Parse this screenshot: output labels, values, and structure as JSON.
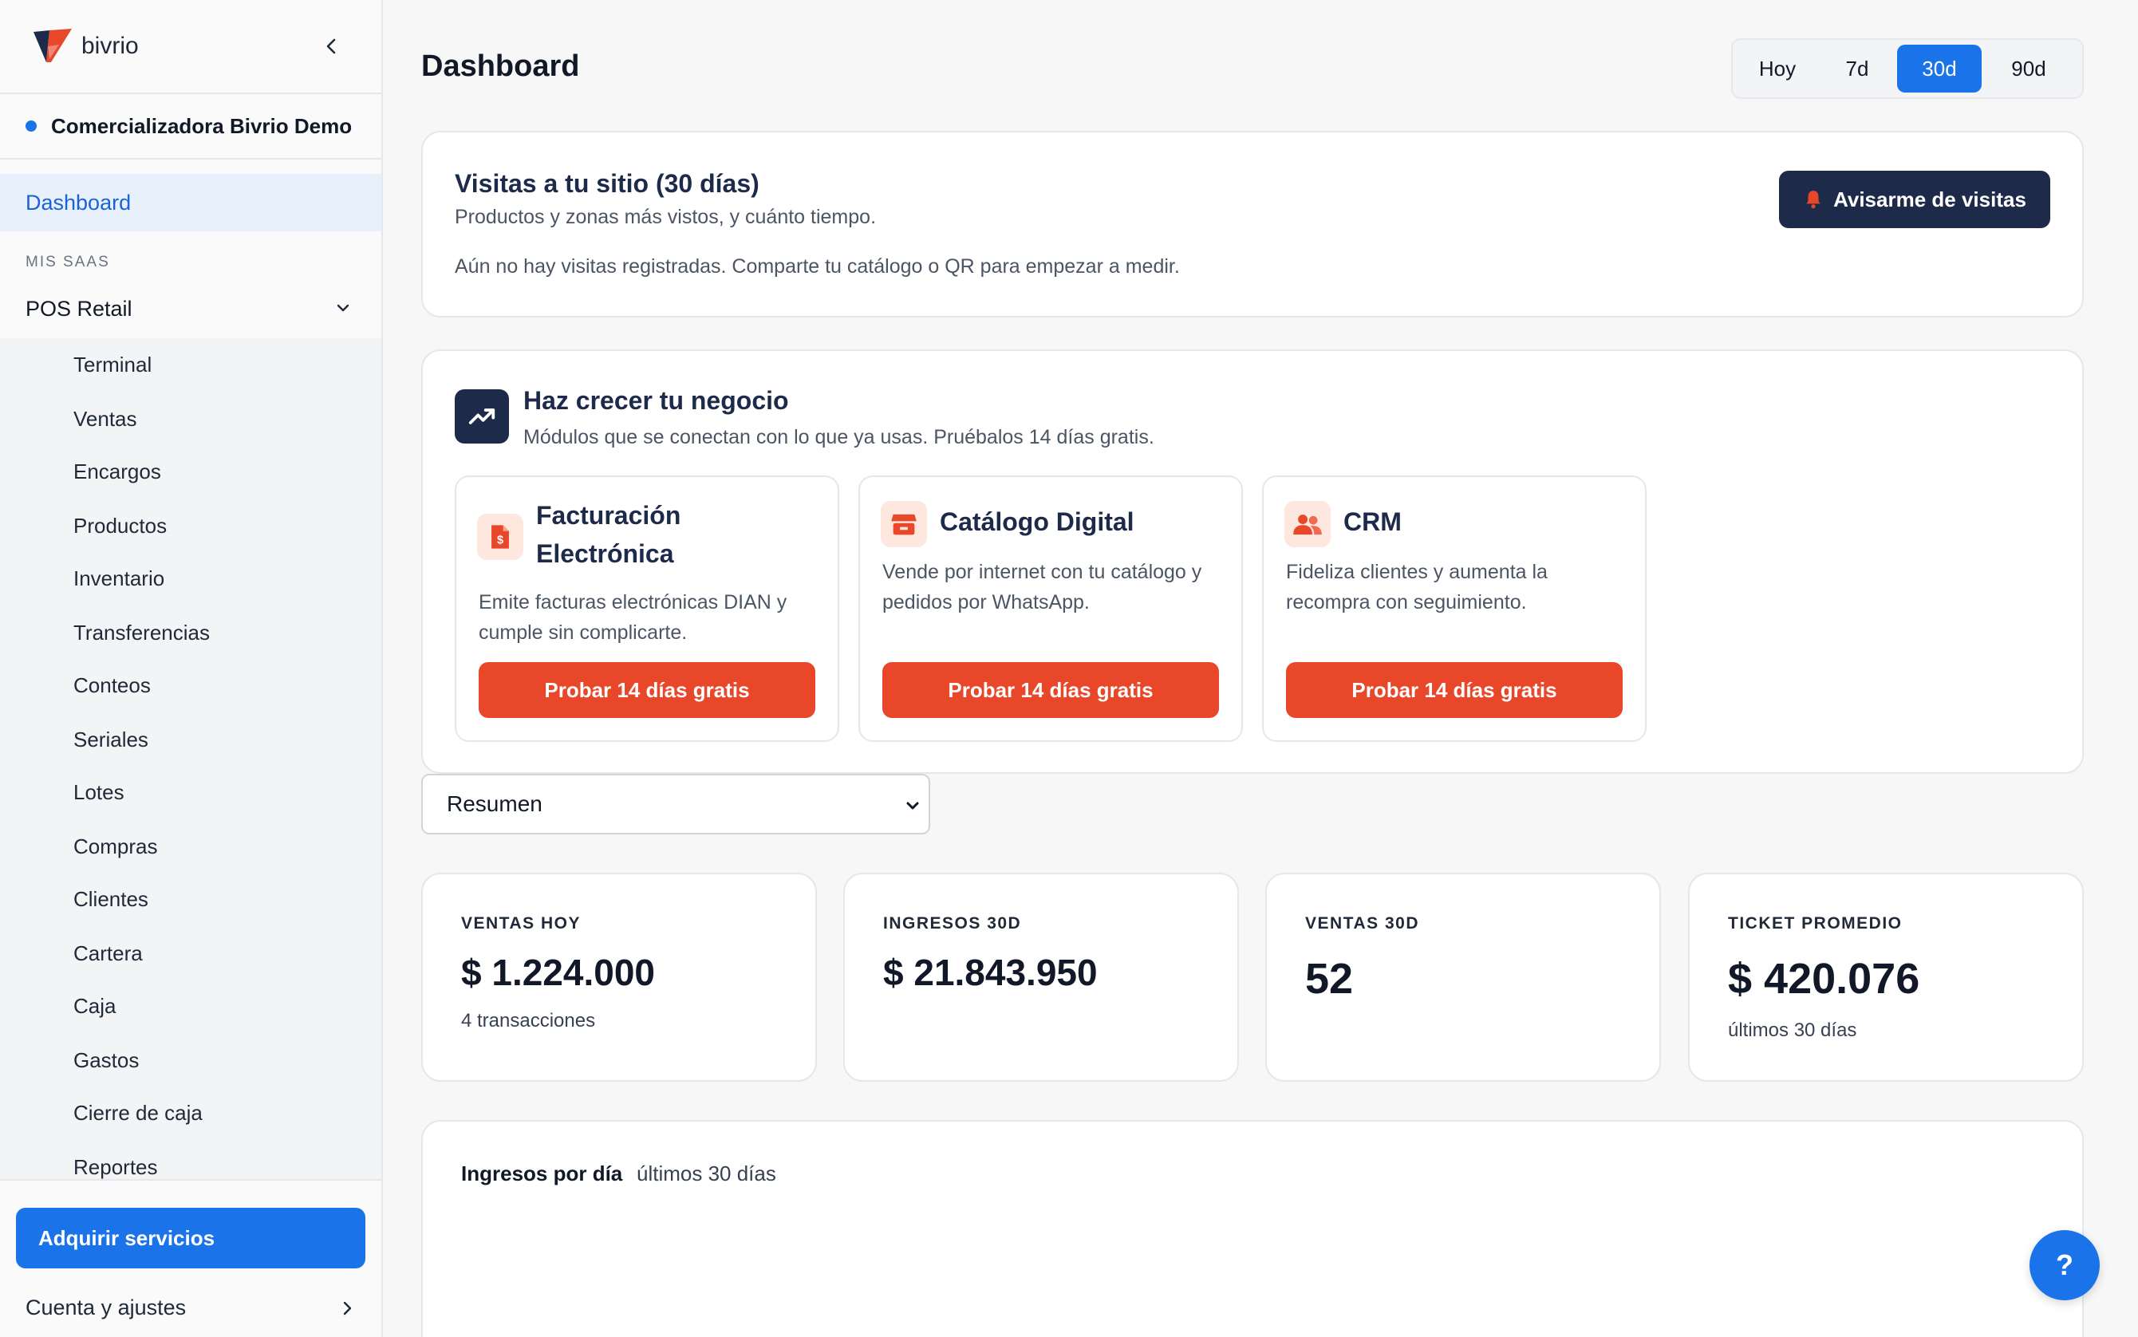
{
  "brand": {
    "name": "bivrio"
  },
  "org": {
    "name": "Comercializadora Bivrio Demo"
  },
  "sidebar": {
    "dashboard_label": "Dashboard",
    "section_label": "MIS SAAS",
    "group_label": "POS Retail",
    "items": [
      "Terminal",
      "Ventas",
      "Encargos",
      "Productos",
      "Inventario",
      "Transferencias",
      "Conteos",
      "Seriales",
      "Lotes",
      "Compras",
      "Clientes",
      "Cartera",
      "Caja",
      "Gastos",
      "Cierre de caja",
      "Reportes"
    ],
    "acquire_label": "Adquirir servicios",
    "account_label": "Cuenta y ajustes"
  },
  "header": {
    "title": "Dashboard",
    "ranges": [
      "Hoy",
      "7d",
      "30d",
      "90d"
    ],
    "active_range": "30d"
  },
  "visits": {
    "title": "Visitas a tu sitio (30 días)",
    "subtitle": "Productos y zonas más vistos, y cuánto tiempo.",
    "empty": "Aún no hay visitas registradas. Comparte tu catálogo o QR para empezar a medir.",
    "notify_label": "Avisarme de visitas"
  },
  "grow": {
    "title": "Haz crecer tu negocio",
    "subtitle": "Módulos que se conectan con lo que ya usas. Pruébalos 14 días gratis.",
    "modules": [
      {
        "title": "Facturación Electrónica",
        "desc": "Emite facturas electrónicas DIAN y cumple sin complicarte.",
        "cta": "Probar 14 días gratis",
        "icon": "invoice-icon"
      },
      {
        "title": "Catálogo Digital",
        "desc": "Vende por internet con tu catálogo y pedidos por WhatsApp.",
        "cta": "Probar 14 días gratis",
        "icon": "store-icon"
      },
      {
        "title": "CRM",
        "desc": "Fideliza clientes y aumenta la recompra con seguimiento.",
        "cta": "Probar 14 días gratis",
        "icon": "users-icon"
      }
    ]
  },
  "view": {
    "selected": "Resumen"
  },
  "kpis": [
    {
      "label": "VENTAS HOY",
      "value": "$ 1.224.000",
      "sub": "4 transacciones"
    },
    {
      "label": "INGRESOS 30D",
      "value": "$ 21.843.950",
      "sub": ""
    },
    {
      "label": "VENTAS 30D",
      "value": "52",
      "sub": ""
    },
    {
      "label": "TICKET PROMEDIO",
      "value": "$ 420.076",
      "sub": "últimos 30 días"
    }
  ],
  "income": {
    "title": "Ingresos por día",
    "subtitle": "últimos 30 días"
  },
  "help": {
    "label": "?"
  },
  "colors": {
    "accent": "#1a73e8",
    "navy": "#1e2a4a",
    "orange": "#e8472a"
  }
}
